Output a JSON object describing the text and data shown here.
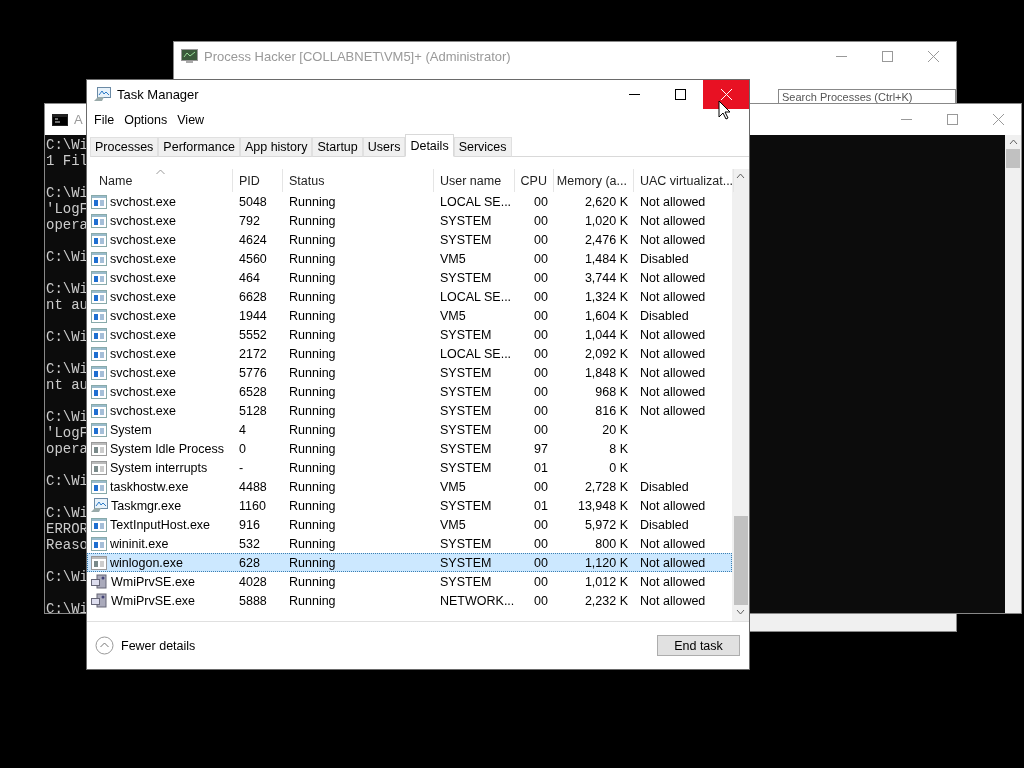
{
  "process_hacker": {
    "title": "Process Hacker [COLLABNET\\VM5]+ (Administrator)",
    "search": {
      "placeholder": "Search Processes (Ctrl+K)"
    }
  },
  "console": {
    "title": "A",
    "blocks": [
      [
        "C:\\Wi",
        "1 Fil"
      ],
      [
        "C:\\Wi",
        "'LogF",
        "opera"
      ],
      [
        "C:\\Wi"
      ],
      [
        "C:\\Wi",
        "nt au"
      ],
      [
        "C:\\Wi"
      ],
      [
        "C:\\Wi",
        "nt au"
      ],
      [
        "C:\\Wi",
        "'LogF",
        "opera"
      ],
      [
        "C:\\Wi"
      ],
      [
        "C:\\Wi",
        "ERROR",
        "Reaso"
      ],
      [
        "C:\\Wi"
      ],
      [
        "C:\\Wi"
      ]
    ]
  },
  "task_manager": {
    "title": "Task Manager",
    "close_hovered": true,
    "menu": [
      "File",
      "Options",
      "View"
    ],
    "tabs": [
      {
        "label": "Processes",
        "selected": false
      },
      {
        "label": "Performance",
        "selected": false
      },
      {
        "label": "App history",
        "selected": false
      },
      {
        "label": "Startup",
        "selected": false
      },
      {
        "label": "Users",
        "selected": false
      },
      {
        "label": "Details",
        "selected": true
      },
      {
        "label": "Services",
        "selected": false
      }
    ],
    "columns": [
      {
        "label": "Name",
        "sorted": true
      },
      {
        "label": "PID",
        "sorted": false
      },
      {
        "label": "Status",
        "sorted": false
      },
      {
        "label": "User name",
        "sorted": false
      },
      {
        "label": "CPU",
        "sorted": false
      },
      {
        "label": "Memory (a...",
        "sorted": false
      },
      {
        "label": "UAC virtualizat...",
        "sorted": false
      }
    ],
    "rows": [
      {
        "kind": "service",
        "name": "svchost.exe",
        "pid": "5048",
        "status": "Running",
        "user": "LOCAL SE...",
        "cpu": "00",
        "memory": "2,620 K",
        "uac": "Not allowed",
        "selected": false
      },
      {
        "kind": "service",
        "name": "svchost.exe",
        "pid": "792",
        "status": "Running",
        "user": "SYSTEM",
        "cpu": "00",
        "memory": "1,020 K",
        "uac": "Not allowed",
        "selected": false
      },
      {
        "kind": "service",
        "name": "svchost.exe",
        "pid": "4624",
        "status": "Running",
        "user": "SYSTEM",
        "cpu": "00",
        "memory": "2,476 K",
        "uac": "Not allowed",
        "selected": false
      },
      {
        "kind": "service",
        "name": "svchost.exe",
        "pid": "4560",
        "status": "Running",
        "user": "VM5",
        "cpu": "00",
        "memory": "1,484 K",
        "uac": "Disabled",
        "selected": false
      },
      {
        "kind": "service",
        "name": "svchost.exe",
        "pid": "464",
        "status": "Running",
        "user": "SYSTEM",
        "cpu": "00",
        "memory": "3,744 K",
        "uac": "Not allowed",
        "selected": false
      },
      {
        "kind": "service",
        "name": "svchost.exe",
        "pid": "6628",
        "status": "Running",
        "user": "LOCAL SE...",
        "cpu": "00",
        "memory": "1,324 K",
        "uac": "Not allowed",
        "selected": false
      },
      {
        "kind": "service",
        "name": "svchost.exe",
        "pid": "1944",
        "status": "Running",
        "user": "VM5",
        "cpu": "00",
        "memory": "1,604 K",
        "uac": "Disabled",
        "selected": false
      },
      {
        "kind": "service",
        "name": "svchost.exe",
        "pid": "5552",
        "status": "Running",
        "user": "SYSTEM",
        "cpu": "00",
        "memory": "1,044 K",
        "uac": "Not allowed",
        "selected": false
      },
      {
        "kind": "service",
        "name": "svchost.exe",
        "pid": "2172",
        "status": "Running",
        "user": "LOCAL SE...",
        "cpu": "00",
        "memory": "2,092 K",
        "uac": "Not allowed",
        "selected": false
      },
      {
        "kind": "service",
        "name": "svchost.exe",
        "pid": "5776",
        "status": "Running",
        "user": "SYSTEM",
        "cpu": "00",
        "memory": "1,848 K",
        "uac": "Not allowed",
        "selected": false
      },
      {
        "kind": "service",
        "name": "svchost.exe",
        "pid": "6528",
        "status": "Running",
        "user": "SYSTEM",
        "cpu": "00",
        "memory": "968 K",
        "uac": "Not allowed",
        "selected": false
      },
      {
        "kind": "service",
        "name": "svchost.exe",
        "pid": "5128",
        "status": "Running",
        "user": "SYSTEM",
        "cpu": "00",
        "memory": "816 K",
        "uac": "Not allowed",
        "selected": false
      },
      {
        "kind": "service",
        "name": "System",
        "pid": "4",
        "status": "Running",
        "user": "SYSTEM",
        "cpu": "00",
        "memory": "20 K",
        "selected": false
      },
      {
        "kind": "generic",
        "name": "System Idle Process",
        "pid": "0",
        "status": "Running",
        "user": "SYSTEM",
        "cpu": "97",
        "memory": "8 K",
        "selected": false
      },
      {
        "kind": "generic",
        "name": "System interrupts",
        "pid": "-",
        "status": "Running",
        "user": "SYSTEM",
        "cpu": "01",
        "memory": "0 K",
        "selected": false
      },
      {
        "kind": "service",
        "name": "taskhostw.exe",
        "pid": "4488",
        "status": "Running",
        "user": "VM5",
        "cpu": "00",
        "memory": "2,728 K",
        "uac": "Disabled",
        "selected": false
      },
      {
        "kind": "monitor",
        "name": "Taskmgr.exe",
        "pid": "1160",
        "status": "Running",
        "user": "SYSTEM",
        "cpu": "01",
        "memory": "13,948 K",
        "uac": "Not allowed",
        "selected": false
      },
      {
        "kind": "service",
        "name": "TextInputHost.exe",
        "pid": "916",
        "status": "Running",
        "user": "VM5",
        "cpu": "00",
        "memory": "5,972 K",
        "uac": "Disabled",
        "selected": false
      },
      {
        "kind": "service",
        "name": "wininit.exe",
        "pid": "532",
        "status": "Running",
        "user": "SYSTEM",
        "cpu": "00",
        "memory": "800 K",
        "uac": "Not allowed",
        "selected": false
      },
      {
        "kind": "generic",
        "name": "winlogon.exe",
        "pid": "628",
        "status": "Running",
        "user": "SYSTEM",
        "cpu": "00",
        "memory": "1,120 K",
        "uac": "Not allowed",
        "selected": true
      },
      {
        "kind": "wmi",
        "name": "WmiPrvSE.exe",
        "pid": "4028",
        "status": "Running",
        "user": "SYSTEM",
        "cpu": "00",
        "memory": "1,012 K",
        "uac": "Not allowed",
        "selected": false
      },
      {
        "kind": "wmi",
        "name": "WmiPrvSE.exe",
        "pid": "5888",
        "status": "Running",
        "user": "NETWORK...",
        "cpu": "00",
        "memory": "2,232 K",
        "uac": "Not allowed",
        "selected": false
      }
    ],
    "footer": {
      "toggle": "Fewer details",
      "button": "End task"
    }
  }
}
